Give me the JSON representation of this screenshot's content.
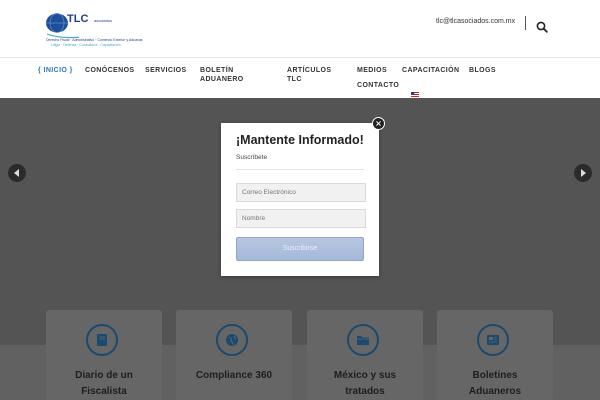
{
  "header": {
    "logo": {
      "brand": "TLC",
      "brand_sub": "asociados",
      "line1": "Derecho Fiscal · Administrativo · Comercio Exterior y Aduanas",
      "line2": "Litigio · Defensa · Consultoría · Capacitación"
    },
    "email": "tlc@tlcasociados.com.mx",
    "search_icon": "search-icon"
  },
  "nav": {
    "items": [
      {
        "label": "{ INICIO }",
        "active": true
      },
      {
        "label": "CONÓCENOS"
      },
      {
        "label": "SERVICIOS"
      },
      {
        "label_line1": "BOLETÍN",
        "label_line2": "ADUANERO"
      },
      {
        "label_line1": "ARTÍCULOS",
        "label_line2": "TLC"
      },
      {
        "label": "MEDIOS"
      },
      {
        "label": "CAPACITACIÓN"
      },
      {
        "label": "BLOGS"
      },
      {
        "label": "CONTACTO"
      }
    ],
    "flag_icon": "us-flag-icon"
  },
  "hero": {
    "prev_icon": "chevron-left-icon",
    "next_icon": "chevron-right-icon"
  },
  "cards": [
    {
      "title_line1": "Diario de un",
      "title_line2": "Fiscalista",
      "icon": "book-icon"
    },
    {
      "title_line1": "Compliance 360",
      "title_line2": "",
      "icon": "globe-icon"
    },
    {
      "title_line1": "México y sus",
      "title_line2": "tratados",
      "icon": "folder-icon"
    },
    {
      "title_line1": "Boletines",
      "title_line2": "Aduaneros",
      "icon": "newspaper-icon"
    }
  ],
  "modal": {
    "title": "¡Mantente Informado!",
    "subtitle": "Suscríbete",
    "email_placeholder": "Correo Electrónico",
    "name_placeholder": "Nombre",
    "button_label": "Suscribirse",
    "close_label": "×"
  },
  "colors": {
    "accent": "#2a7ab5",
    "overlay": "#545454",
    "button": "#a4b8d8",
    "icon_ring": "#1b4a70"
  }
}
